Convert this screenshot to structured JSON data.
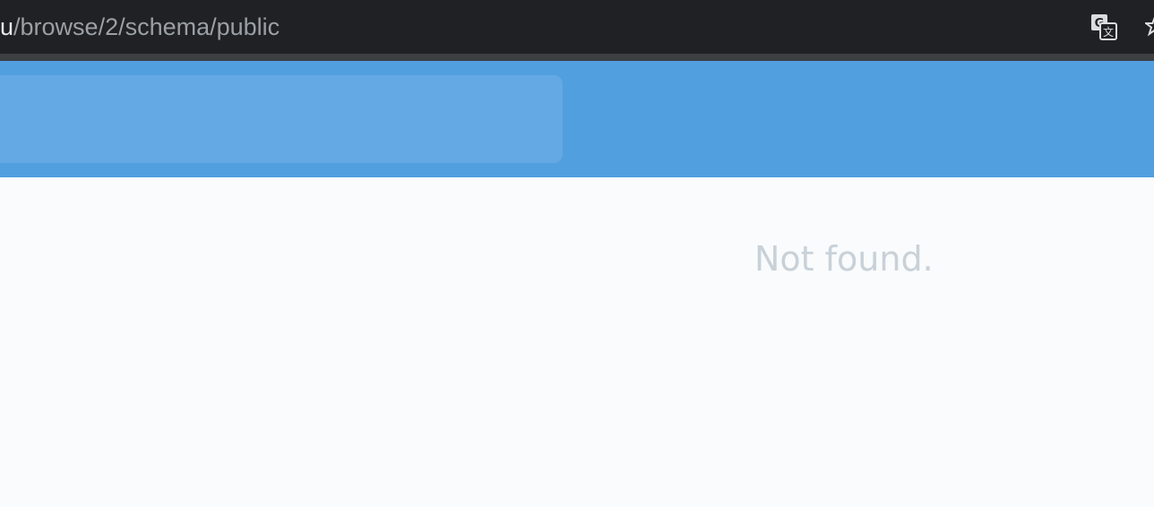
{
  "browser": {
    "url_host_fragment": "u",
    "url_path": "/browse/2/schema/public",
    "icons": [
      "translate-icon",
      "star-icon"
    ]
  },
  "main": {
    "message": "Not found."
  },
  "colors": {
    "browser_bg": "#202124",
    "header_bg": "#529fe0",
    "search_bg": "#64a9e4",
    "content_bg": "#f9fbfc",
    "message_text": "#c9d1d8"
  }
}
